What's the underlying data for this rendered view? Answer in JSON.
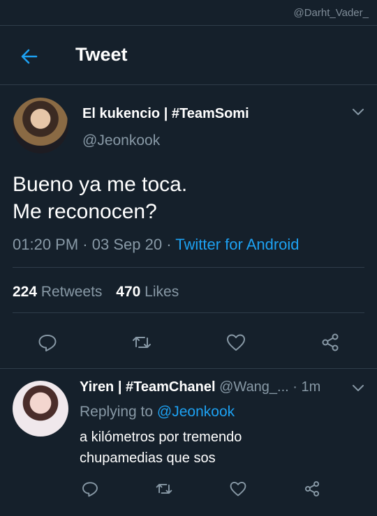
{
  "watermark": "@Darht_Vader_",
  "header": {
    "title": "Tweet"
  },
  "tweet": {
    "author_name": "El kukencio | #TeamSomi",
    "author_handle": "@Jeonkook",
    "text_line1": "Bueno ya me toca.",
    "text_line2": "Me reconocen?",
    "time": "01:20 PM",
    "date": "03 Sep 20",
    "source": "Twitter for Android",
    "retweet_count": "224",
    "retweet_label": "Retweets",
    "like_count": "470",
    "like_label": "Likes"
  },
  "reply": {
    "author_name": "Yiren | #TeamChanel",
    "author_handle": "@Wang_...",
    "age": "1m",
    "replying_prefix": "Replying to",
    "replying_to": "@Jeonkook",
    "text_line1": "a kilómetros por tremendo",
    "text_line2": "chupamedias que sos"
  },
  "colors": {
    "background": "#15202b",
    "accent": "#1da1f2",
    "muted": "#8899a6"
  },
  "icons": [
    "arrow-left-icon",
    "chevron-down-icon",
    "reply-icon",
    "retweet-icon",
    "like-icon",
    "share-icon"
  ]
}
